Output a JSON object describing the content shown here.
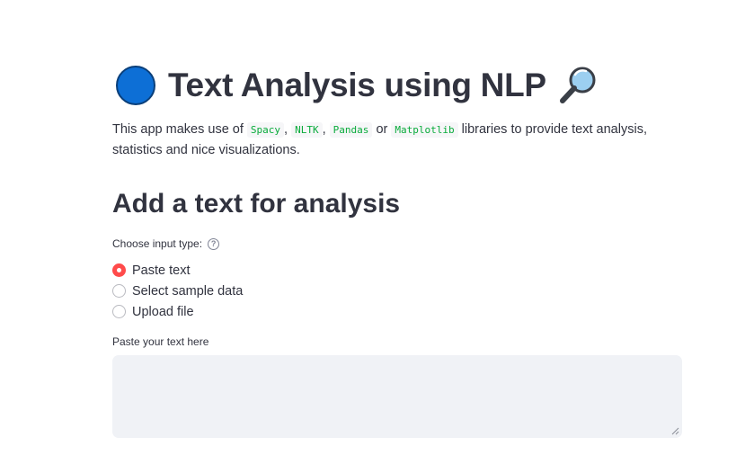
{
  "header": {
    "title": "Text Analysis using NLP",
    "leading_icon": "blue-circle-icon",
    "trailing_icon": "magnifying-glass-icon"
  },
  "intro": {
    "prefix": "This app makes use of",
    "libs": [
      "Spacy",
      "NLTK",
      "Pandas",
      "Matplotlib"
    ],
    "sep1": ",",
    "sep2": ",",
    "sep3": "or",
    "suffix": "libraries to provide text analysis, statistics and nice visualizations."
  },
  "section": {
    "heading": "Add a text for analysis"
  },
  "input_type": {
    "label": "Choose input type:",
    "help_icon": "question-circle-icon",
    "options": [
      "Paste text",
      "Select sample data",
      "Upload file"
    ],
    "selected": "Paste text"
  },
  "text_input": {
    "label": "Paste your text here",
    "value": "",
    "placeholder": ""
  },
  "colors": {
    "accent": "#ff4b4b",
    "code_text": "#09ab3b",
    "text": "#31333f",
    "input_bg": "#f0f2f6"
  }
}
